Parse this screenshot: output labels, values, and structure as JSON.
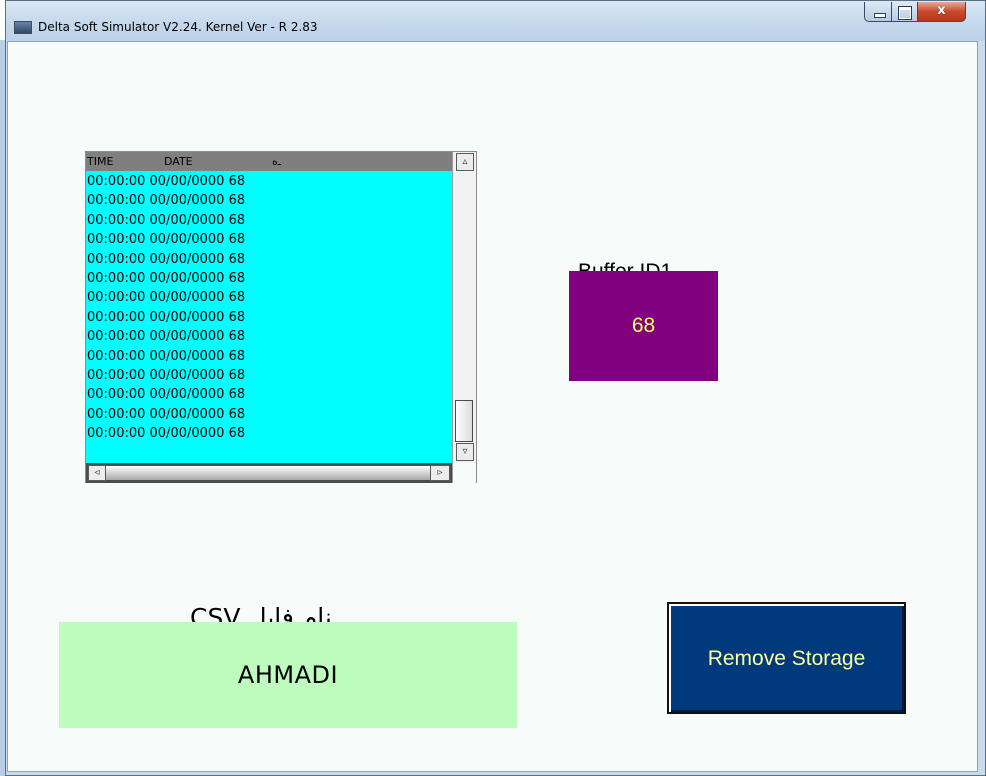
{
  "window": {
    "title": "Delta Soft Simulator V2.24. Kernel Ver - R 2.83",
    "minimize_glyph": "_",
    "maximize_glyph": "□",
    "close_glyph": "x"
  },
  "data_list": {
    "headers": {
      "time": "TIME",
      "date": "DATE",
      "value": "ـﻩ"
    },
    "rows": [
      "00:00:00 00/00/0000 68",
      "00:00:00 00/00/0000 68",
      "00:00:00 00/00/0000 68",
      "00:00:00 00/00/0000 68",
      "00:00:00 00/00/0000 68",
      "00:00:00 00/00/0000 68",
      "00:00:00 00/00/0000 68",
      "00:00:00 00/00/0000 68",
      "00:00:00 00/00/0000 68",
      "00:00:00 00/00/0000 68",
      "00:00:00 00/00/0000 68",
      "00:00:00 00/00/0000 68",
      "00:00:00 00/00/0000 68",
      "00:00:00 00/00/0000 68"
    ],
    "scroll_up": "▵",
    "scroll_down": "▿",
    "scroll_left": "◃",
    "scroll_right": "▹"
  },
  "buffer": {
    "label": "Buffer ID1",
    "value": "68",
    "box_color": "#800080",
    "text_color": "#ffff66"
  },
  "csv": {
    "label": "نام فایل CSV",
    "file_name": "AHMADI",
    "box_color": "#bdfcbd"
  },
  "remove_storage": {
    "label": "Remove Storage",
    "box_color": "#003a7d",
    "text_color": "#ffff99"
  }
}
